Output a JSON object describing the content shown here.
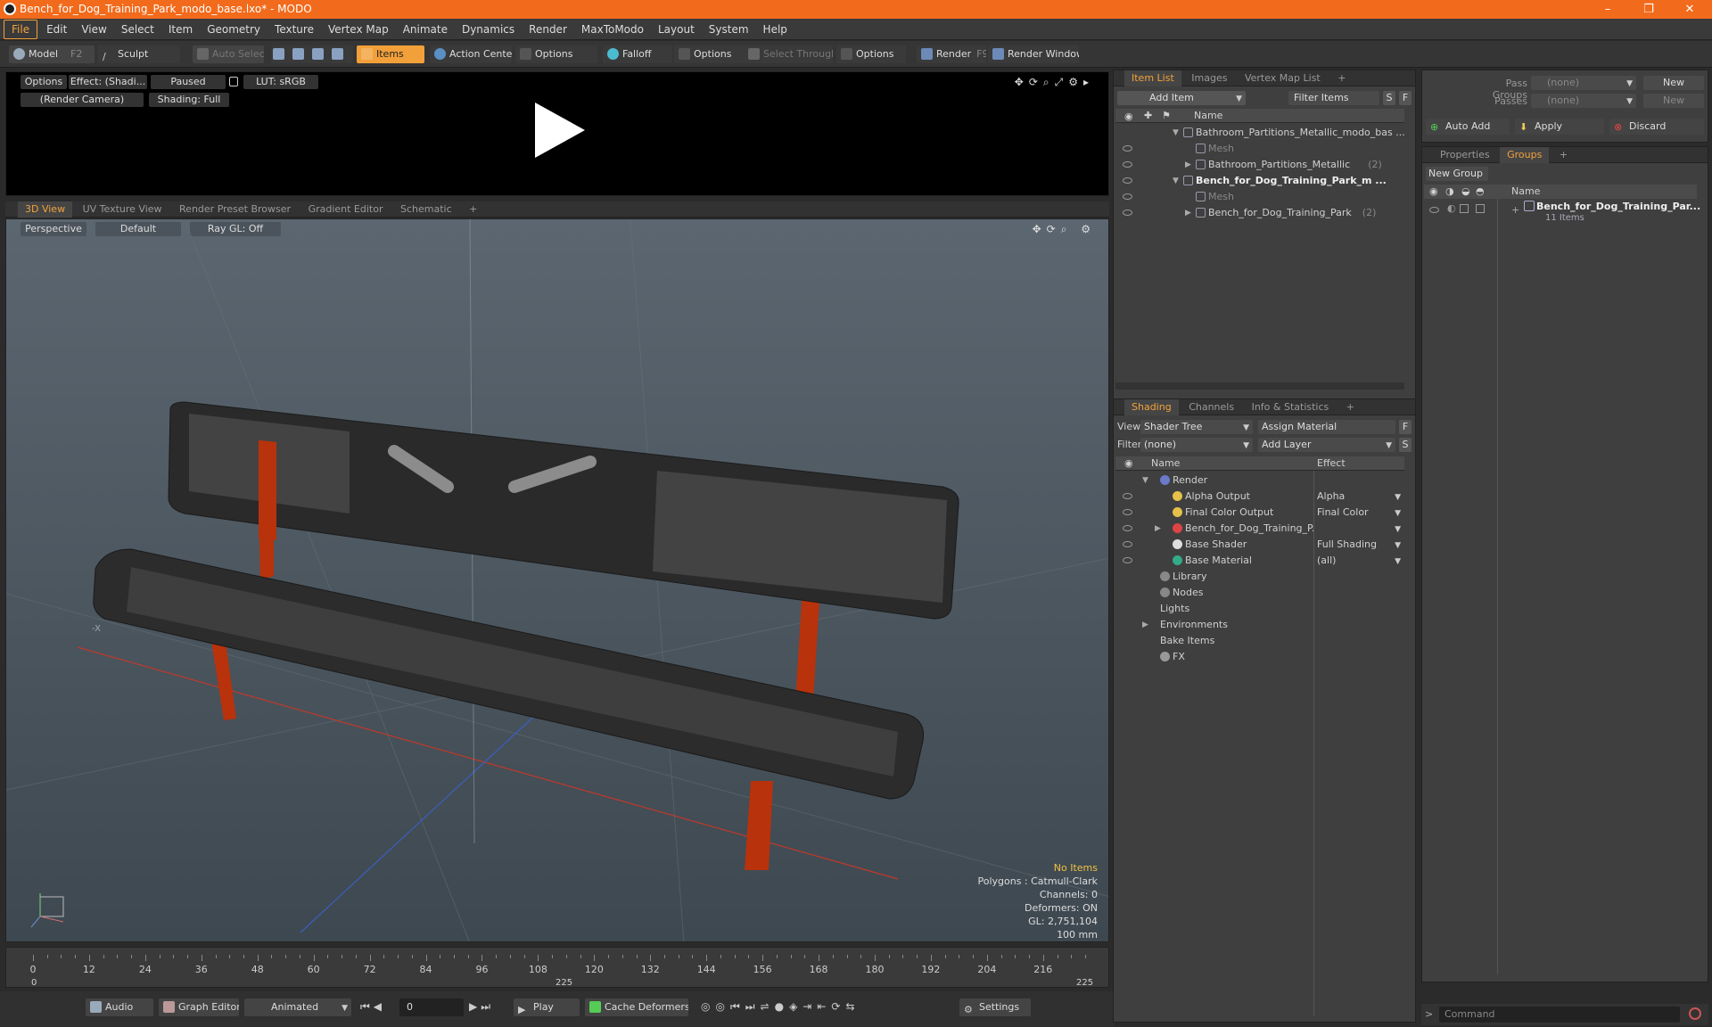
{
  "window": {
    "title": "Bench_for_Dog_Training_Park_modo_base.lxo* - MODO",
    "min": "–",
    "max": "❐",
    "close": "✕"
  },
  "menu": [
    "File",
    "Edit",
    "View",
    "Select",
    "Item",
    "Geometry",
    "Texture",
    "Vertex Map",
    "Animate",
    "Dynamics",
    "Render",
    "MaxToModo",
    "Layout",
    "System",
    "Help"
  ],
  "toolbar": {
    "model": "Model",
    "model_key": "F2",
    "sculpt": "Sculpt",
    "auto_select": "Auto Select",
    "items": "Items",
    "action_center": "Action Center",
    "options1": "Options",
    "falloff": "Falloff",
    "options2": "Options",
    "select_through": "Select Through",
    "options3": "Options",
    "render": "Render",
    "render_key": "F9",
    "render_window": "Render Window"
  },
  "preview": {
    "options": "Options",
    "effect": "Effect: (Shadi...",
    "paused": "Paused",
    "lut": "LUT: sRGB",
    "camera": "(Render Camera)",
    "shading": "Shading: Full"
  },
  "viewport_tabs": [
    "3D View",
    "UV Texture View",
    "Render Preset Browser",
    "Gradient Editor",
    "Schematic",
    "+"
  ],
  "viewport": {
    "perspective": "Perspective",
    "default": "Default",
    "raygl": "Ray GL: Off",
    "hud_noitems": "No Items",
    "hud_polygons": "Polygons : Catmull-Clark",
    "hud_channels": "Channels: 0",
    "hud_deformers": "Deformers: ON",
    "hud_gl": "GL: 2,751,104",
    "hud_size": "100 mm",
    "axis_label": "-X"
  },
  "timeline": {
    "ticks": [
      "0",
      "12",
      "24",
      "36",
      "48",
      "60",
      "72",
      "84",
      "96",
      "108",
      "120",
      "132",
      "144",
      "156",
      "168",
      "180",
      "192",
      "204",
      "216"
    ],
    "start": "0",
    "mid": "225",
    "end": "225"
  },
  "bottombar": {
    "audio": "Audio",
    "graph_editor": "Graph Editor",
    "animated": "Animated",
    "frame": "0",
    "play": "Play",
    "cache": "Cache Deformers",
    "settings": "Settings"
  },
  "itemlist": {
    "tabs": [
      "Item List",
      "Images",
      "Vertex Map List",
      "+"
    ],
    "add_item": "Add Item",
    "filter": "Filter Items",
    "s": "S",
    "f": "F",
    "col_name": "Name",
    "rows": [
      {
        "label": "Bathroom_Partitions_Metallic_modo_bas ...",
        "count": ""
      },
      {
        "label": "Mesh",
        "count": ""
      },
      {
        "label": "Bathroom_Partitions_Metallic",
        "count": "(2)"
      },
      {
        "label": "Bench_for_Dog_Training_Park_m ...",
        "count": ""
      },
      {
        "label": "Mesh",
        "count": ""
      },
      {
        "label": "Bench_for_Dog_Training_Park",
        "count": "(2)"
      }
    ]
  },
  "shading": {
    "tabs": [
      "Shading",
      "Channels",
      "Info & Statistics",
      "+"
    ],
    "view_label": "View",
    "view_value": "Shader Tree",
    "assign": "Assign Material",
    "f": "F",
    "filter_label": "Filter",
    "filter_value": "(none)",
    "add_layer": "Add Layer",
    "s": "S",
    "col_name": "Name",
    "col_effect": "Effect",
    "rows": [
      {
        "label": "Render",
        "effect": ""
      },
      {
        "label": "Alpha Output",
        "effect": "Alpha"
      },
      {
        "label": "Final Color Output",
        "effect": "Final Color"
      },
      {
        "label": "Bench_for_Dog_Training_P...",
        "effect": ""
      },
      {
        "label": "Base Shader",
        "effect": "Full Shading"
      },
      {
        "label": "Base Material",
        "effect": "(all)"
      },
      {
        "label": "Library",
        "effect": ""
      },
      {
        "label": "Nodes",
        "effect": ""
      },
      {
        "label": "Lights",
        "effect": ""
      },
      {
        "label": "Environments",
        "effect": ""
      },
      {
        "label": "Bake Items",
        "effect": ""
      },
      {
        "label": "FX",
        "effect": ""
      }
    ]
  },
  "passes": {
    "pass_groups": "Pass Groups",
    "pass_value": "(none)",
    "new1": "New",
    "passes": "Passes",
    "passes_value": "(none)",
    "new2": "New",
    "auto_add": "Auto Add",
    "apply": "Apply",
    "discard": "Discard"
  },
  "groups": {
    "tabs": [
      "Properties",
      "Groups",
      "+"
    ],
    "new_group": "New Group",
    "col_name": "Name",
    "item": "Bench_for_Dog_Training_Par...",
    "sub": "11 Items"
  },
  "command": {
    "placeholder": "Command"
  }
}
